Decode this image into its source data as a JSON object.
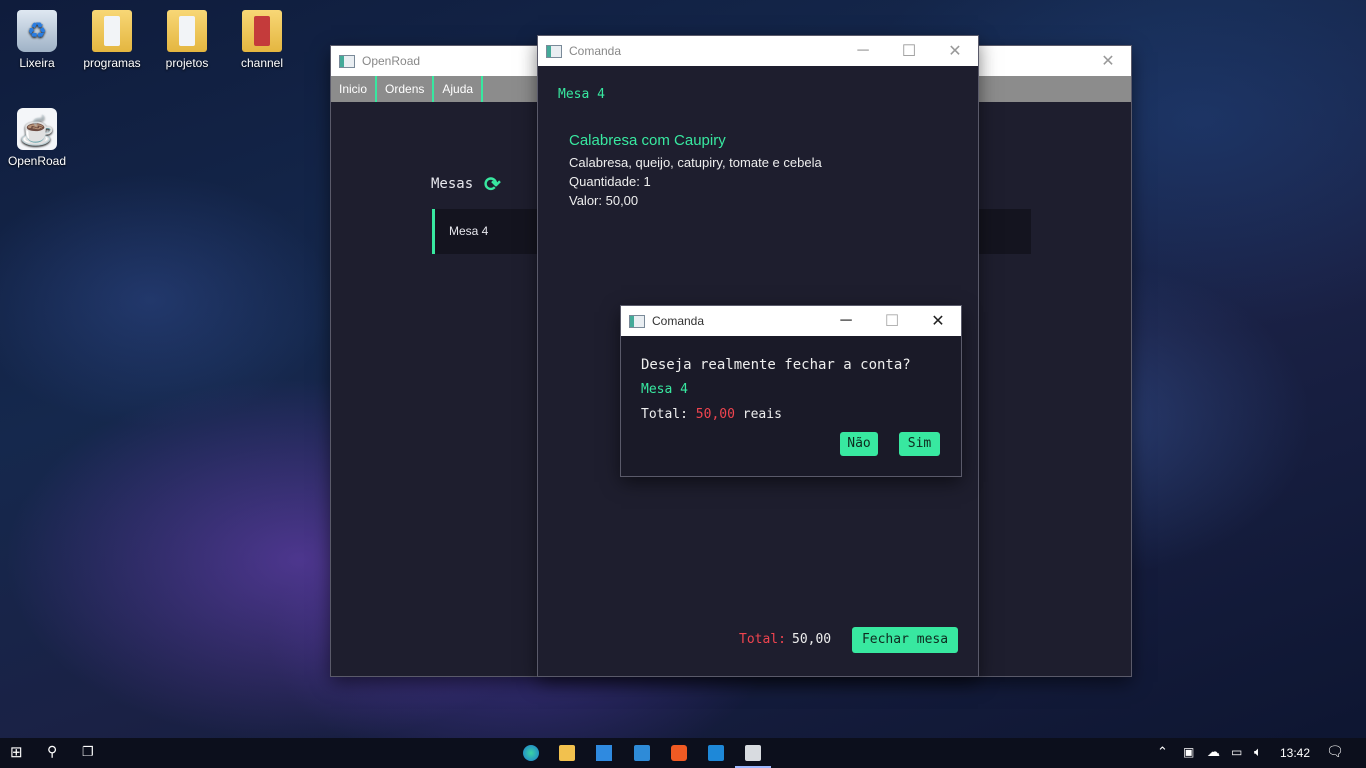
{
  "desktop": {
    "icons": [
      {
        "label": "Lixeira",
        "icon": "recycle-bin-icon"
      },
      {
        "label": "programas",
        "icon": "folder-icon"
      },
      {
        "label": "projetos",
        "icon": "folder-icon"
      },
      {
        "label": "channel",
        "icon": "folder-shortcut-icon"
      },
      {
        "label": "OpenRoad",
        "icon": "java-icon"
      }
    ]
  },
  "main_window": {
    "title": "OpenRoad",
    "menu": [
      "Inicio",
      "Ordens",
      "Ajuda"
    ],
    "mesas_title": "Mesas",
    "rows": [
      "Mesa 4"
    ]
  },
  "comanda_window": {
    "title": "Comanda",
    "mesa_label": "Mesa 4",
    "item": {
      "name": "Calabresa com Caupiry",
      "description": "Calabresa, queijo, catupiry, tomate e cebela",
      "quantity": "Quantidade: 1",
      "value": "Valor: 50,00"
    },
    "total_label": "Total:",
    "total_value": "50,00",
    "close_button": "Fechar mesa"
  },
  "dialog": {
    "title": "Comanda",
    "question": "Deseja realmente fechar a conta?",
    "mesa": "Mesa 4",
    "total_prefix": "Total:",
    "total_value": "50,00",
    "total_suffix": "reais",
    "no_button": "Não",
    "yes_button": "Sim"
  },
  "taskbar": {
    "clock": "13:42"
  },
  "colors": {
    "accent": "#38e8a0",
    "danger": "#f0444f",
    "panel": "#1e1e2e"
  }
}
